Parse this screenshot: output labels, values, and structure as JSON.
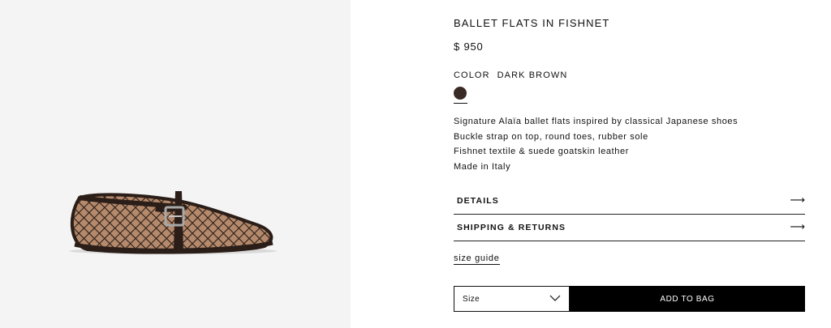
{
  "product": {
    "title": "BALLET FLATS IN FISHNET",
    "price": "$ 950",
    "color_label": "COLOR",
    "color_value": "DARK BROWN",
    "swatch_color": "#3a2a25",
    "image_icon": "ballet-flat-product-image",
    "description": [
      "Signature Alaïa ballet flats inspired by classical Japanese shoes",
      "Buckle strap on top, round toes, rubber sole",
      "Fishnet textile & suede goatskin leather",
      "Made in Italy"
    ]
  },
  "accordions": [
    {
      "label": "DETAILS",
      "icon": "arrow-right-icon"
    },
    {
      "label": "SHIPPING & RETURNS",
      "icon": "arrow-right-icon"
    }
  ],
  "size_guide": "size guide",
  "size_select": {
    "label": "Size",
    "icon": "chevron-down-icon"
  },
  "add_to_bag": "ADD TO BAG",
  "colors": {
    "button_bg": "#000000",
    "image_bg": "#f4f4f4"
  }
}
